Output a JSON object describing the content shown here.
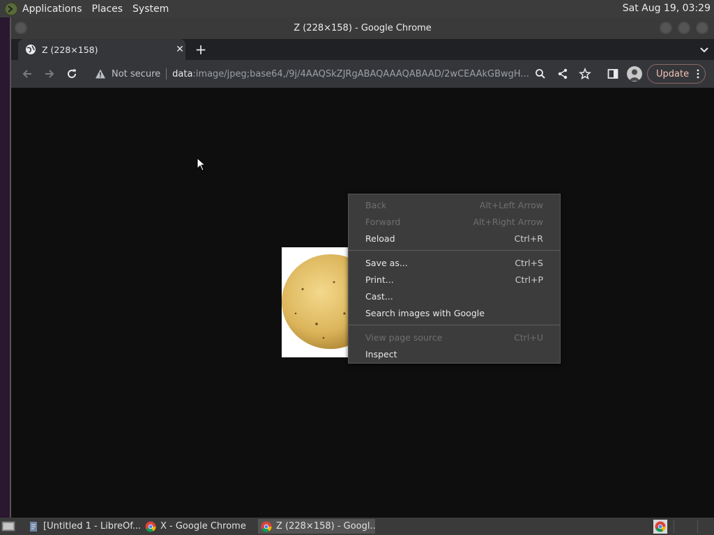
{
  "top_panel": {
    "menus": [
      "Applications",
      "Places",
      "System"
    ],
    "clock": "Sat Aug 19, 03:29"
  },
  "window": {
    "title": "Z (228×158) - Google Chrome"
  },
  "tab": {
    "title": "Z (228×158)",
    "close": "✕",
    "new_tab": "+"
  },
  "toolbar": {
    "not_secure": "Not secure",
    "url_scheme": "data",
    "url_rest": ":image/jpeg;base64,/9j/4AAQSkZJRgABAQAAAQABAAD/2wCEAAkGBwgH...",
    "update_label": "Update"
  },
  "context_menu": {
    "groups": [
      [
        {
          "label": "Back",
          "shortcut": "Alt+Left Arrow",
          "disabled": true
        },
        {
          "label": "Forward",
          "shortcut": "Alt+Right Arrow",
          "disabled": true
        },
        {
          "label": "Reload",
          "shortcut": "Ctrl+R",
          "disabled": false
        }
      ],
      [
        {
          "label": "Save as...",
          "shortcut": "Ctrl+S",
          "disabled": false
        },
        {
          "label": "Print...",
          "shortcut": "Ctrl+P",
          "disabled": false
        },
        {
          "label": "Cast...",
          "shortcut": "",
          "disabled": false
        },
        {
          "label": "Search images with Google",
          "shortcut": "",
          "disabled": false
        }
      ],
      [
        {
          "label": "View page source",
          "shortcut": "Ctrl+U",
          "disabled": true
        },
        {
          "label": "Inspect",
          "shortcut": "",
          "disabled": false
        }
      ]
    ]
  },
  "taskbar": {
    "items": [
      {
        "label": "[Untitled 1 - LibreOf...",
        "icon": "document-icon",
        "active": false
      },
      {
        "label": "X - Google Chrome",
        "icon": "chrome-icon",
        "active": false
      },
      {
        "label": "Z (228×158) - Googl...",
        "icon": "chrome-icon",
        "active": true
      }
    ]
  },
  "colors": {
    "panel": "#3c3c3c",
    "chrome_toolbar": "#35363a",
    "tabstrip": "#202124",
    "content_bg": "#0e0e0e",
    "menu_bg": "#3c3c3c",
    "update_accent": "#f1c3b8"
  }
}
